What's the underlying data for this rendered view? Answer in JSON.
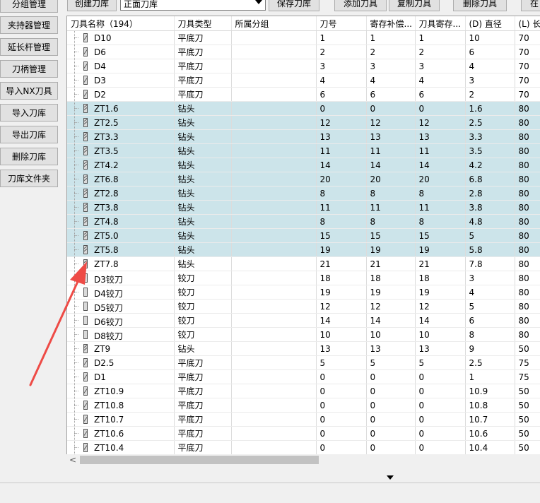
{
  "sidebar": {
    "items": [
      "分组管理",
      "夹持器管理",
      "延长杆管理",
      "刀柄管理",
      "导入NX刀具",
      "导入刀库",
      "导出刀库",
      "删除刀库",
      "刀库文件夹"
    ]
  },
  "toolbar": {
    "create_label": "创建刀库",
    "library_value": "正面刀库",
    "save_label": "保存刀库",
    "add_label": "添加刀具",
    "copy_label": "复制刀具",
    "delete_label": "删除刀具",
    "extra_label": "在"
  },
  "table": {
    "columns": [
      "刀具名称（194）",
      "刀具类型",
      "所属分组",
      "刀号",
      "寄存补偿...",
      "刀具寄存...",
      "(D) 直径",
      "(L) 长度"
    ],
    "rows": [
      {
        "name": "D10",
        "type": "平底刀",
        "group": "",
        "tool_no": "1",
        "comp": "1",
        "reg": "1",
        "diameter": "10",
        "length": "70",
        "selected": false,
        "icon": "mill"
      },
      {
        "name": "D6",
        "type": "平底刀",
        "group": "",
        "tool_no": "2",
        "comp": "2",
        "reg": "2",
        "diameter": "6",
        "length": "70",
        "selected": false,
        "icon": "mill"
      },
      {
        "name": "D4",
        "type": "平底刀",
        "group": "",
        "tool_no": "3",
        "comp": "3",
        "reg": "3",
        "diameter": "4",
        "length": "70",
        "selected": false,
        "icon": "mill"
      },
      {
        "name": "D3",
        "type": "平底刀",
        "group": "",
        "tool_no": "4",
        "comp": "4",
        "reg": "4",
        "diameter": "3",
        "length": "70",
        "selected": false,
        "icon": "mill"
      },
      {
        "name": "D2",
        "type": "平底刀",
        "group": "",
        "tool_no": "6",
        "comp": "6",
        "reg": "6",
        "diameter": "2",
        "length": "70",
        "selected": false,
        "icon": "mill"
      },
      {
        "name": "ZT1.6",
        "type": "钻头",
        "group": "",
        "tool_no": "0",
        "comp": "0",
        "reg": "0",
        "diameter": "1.6",
        "length": "80",
        "selected": true,
        "icon": "drill"
      },
      {
        "name": "ZT2.5",
        "type": "钻头",
        "group": "",
        "tool_no": "12",
        "comp": "12",
        "reg": "12",
        "diameter": "2.5",
        "length": "80",
        "selected": true,
        "icon": "drill"
      },
      {
        "name": "ZT3.3",
        "type": "钻头",
        "group": "",
        "tool_no": "13",
        "comp": "13",
        "reg": "13",
        "diameter": "3.3",
        "length": "80",
        "selected": true,
        "icon": "drill"
      },
      {
        "name": "ZT3.5",
        "type": "钻头",
        "group": "",
        "tool_no": "11",
        "comp": "11",
        "reg": "11",
        "diameter": "3.5",
        "length": "80",
        "selected": true,
        "icon": "drill"
      },
      {
        "name": "ZT4.2",
        "type": "钻头",
        "group": "",
        "tool_no": "14",
        "comp": "14",
        "reg": "14",
        "diameter": "4.2",
        "length": "80",
        "selected": true,
        "icon": "drill"
      },
      {
        "name": "ZT6.8",
        "type": "钻头",
        "group": "",
        "tool_no": "20",
        "comp": "20",
        "reg": "20",
        "diameter": "6.8",
        "length": "80",
        "selected": true,
        "icon": "drill"
      },
      {
        "name": "ZT2.8",
        "type": "钻头",
        "group": "",
        "tool_no": "8",
        "comp": "8",
        "reg": "8",
        "diameter": "2.8",
        "length": "80",
        "selected": true,
        "icon": "drill"
      },
      {
        "name": "ZT3.8",
        "type": "钻头",
        "group": "",
        "tool_no": "11",
        "comp": "11",
        "reg": "11",
        "diameter": "3.8",
        "length": "80",
        "selected": true,
        "icon": "drill"
      },
      {
        "name": "ZT4.8",
        "type": "钻头",
        "group": "",
        "tool_no": "8",
        "comp": "8",
        "reg": "8",
        "diameter": "4.8",
        "length": "80",
        "selected": true,
        "icon": "drill"
      },
      {
        "name": "ZT5.0",
        "type": "钻头",
        "group": "",
        "tool_no": "15",
        "comp": "15",
        "reg": "15",
        "diameter": "5",
        "length": "80",
        "selected": true,
        "icon": "drill"
      },
      {
        "name": "ZT5.8",
        "type": "钻头",
        "group": "",
        "tool_no": "19",
        "comp": "19",
        "reg": "19",
        "diameter": "5.8",
        "length": "80",
        "selected": true,
        "icon": "drill"
      },
      {
        "name": "ZT7.8",
        "type": "钻头",
        "group": "",
        "tool_no": "21",
        "comp": "21",
        "reg": "21",
        "diameter": "7.8",
        "length": "80",
        "selected": false,
        "icon": "drill"
      },
      {
        "name": "D3铰刀",
        "type": "铰刀",
        "group": "",
        "tool_no": "18",
        "comp": "18",
        "reg": "18",
        "diameter": "3",
        "length": "80",
        "selected": false,
        "icon": "ream"
      },
      {
        "name": "D4铰刀",
        "type": "铰刀",
        "group": "",
        "tool_no": "19",
        "comp": "19",
        "reg": "19",
        "diameter": "4",
        "length": "80",
        "selected": false,
        "icon": "ream"
      },
      {
        "name": "D5铰刀",
        "type": "铰刀",
        "group": "",
        "tool_no": "12",
        "comp": "12",
        "reg": "12",
        "diameter": "5",
        "length": "80",
        "selected": false,
        "icon": "ream"
      },
      {
        "name": "D6铰刀",
        "type": "铰刀",
        "group": "",
        "tool_no": "14",
        "comp": "14",
        "reg": "14",
        "diameter": "6",
        "length": "80",
        "selected": false,
        "icon": "ream"
      },
      {
        "name": "D8铰刀",
        "type": "铰刀",
        "group": "",
        "tool_no": "10",
        "comp": "10",
        "reg": "10",
        "diameter": "8",
        "length": "80",
        "selected": false,
        "icon": "ream"
      },
      {
        "name": "ZT9",
        "type": "钻头",
        "group": "",
        "tool_no": "13",
        "comp": "13",
        "reg": "13",
        "diameter": "9",
        "length": "50",
        "selected": false,
        "icon": "drill"
      },
      {
        "name": "D2.5",
        "type": "平底刀",
        "group": "",
        "tool_no": "5",
        "comp": "5",
        "reg": "5",
        "diameter": "2.5",
        "length": "75",
        "selected": false,
        "icon": "mill"
      },
      {
        "name": "D1",
        "type": "平底刀",
        "group": "",
        "tool_no": "0",
        "comp": "0",
        "reg": "0",
        "diameter": "1",
        "length": "75",
        "selected": false,
        "icon": "mill"
      },
      {
        "name": "ZT10.9",
        "type": "平底刀",
        "group": "",
        "tool_no": "0",
        "comp": "0",
        "reg": "0",
        "diameter": "10.9",
        "length": "50",
        "selected": false,
        "icon": "mill"
      },
      {
        "name": "ZT10.8",
        "type": "平底刀",
        "group": "",
        "tool_no": "0",
        "comp": "0",
        "reg": "0",
        "diameter": "10.8",
        "length": "50",
        "selected": false,
        "icon": "mill"
      },
      {
        "name": "ZT10.7",
        "type": "平底刀",
        "group": "",
        "tool_no": "0",
        "comp": "0",
        "reg": "0",
        "diameter": "10.7",
        "length": "50",
        "selected": false,
        "icon": "mill"
      },
      {
        "name": "ZT10.6",
        "type": "平底刀",
        "group": "",
        "tool_no": "0",
        "comp": "0",
        "reg": "0",
        "diameter": "10.6",
        "length": "50",
        "selected": false,
        "icon": "mill"
      },
      {
        "name": "ZT10.4",
        "type": "平底刀",
        "group": "",
        "tool_no": "0",
        "comp": "0",
        "reg": "0",
        "diameter": "10.4",
        "length": "50",
        "selected": false,
        "icon": "mill"
      }
    ]
  },
  "scrollbar": {
    "left_arrow": "<"
  },
  "colors": {
    "selected_row": "#cce4ea",
    "annotation_arrow": "#ee4b46"
  }
}
